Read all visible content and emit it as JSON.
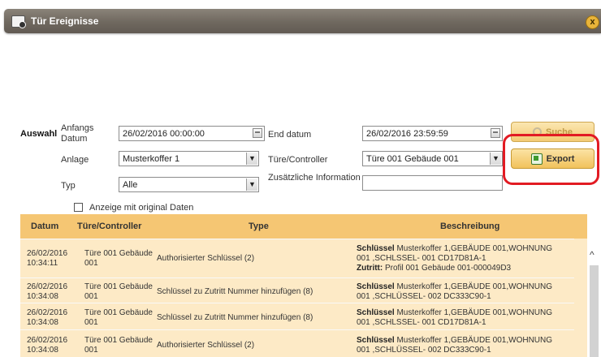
{
  "window": {
    "title": "Tür Ereignisse",
    "close_glyph": "x"
  },
  "filters": {
    "section_label": "Auswahl",
    "start_label_line1": "Anfangs",
    "start_label_line2": "Datum",
    "start_value": "26/02/2016 00:00:00",
    "end_label": "End datum",
    "end_value": "26/02/2016 23:59:59",
    "anlage_label": "Anlage",
    "anlage_value": "Musterkoffer 1",
    "door_label": "Türe/Controller",
    "door_value": "Türe 001 Gebäude 001",
    "typ_label": "Typ",
    "typ_value": "Alle",
    "extra_label": "Zusätzliche Information",
    "extra_value": "",
    "original_data_label": "Anzeige mit original Daten"
  },
  "buttons": {
    "search_label": "Suche",
    "export_label": "Export"
  },
  "table": {
    "headers": [
      "Datum",
      "Türe/Controller",
      "Type",
      "Beschreibung"
    ],
    "rows": [
      {
        "date1": "26/02/2016",
        "date2": "10:34:11",
        "door1": "Türe 001 Gebäude",
        "door2": "001",
        "type": "Authorisierter Schlüssel (2)",
        "desc_bold": "Schlüssel",
        "desc1": " Musterkoffer 1,GEBÄUDE 001,WOHNUNG",
        "desc2": "001 ,SCHLSSEL- 001 CD17D81A-1",
        "desc3_bold": "Zutritt:",
        "desc3": " Profil 001 Gebäude 001-000049D3"
      },
      {
        "date1": "26/02/2016",
        "date2": "10:34:08",
        "door1": "Türe 001 Gebäude",
        "door2": "001",
        "type": "Schlüssel zu Zutritt Nummer hinzufügen (8)",
        "desc_bold": "Schlüssel",
        "desc1": " Musterkoffer 1,GEBÄUDE 001,WOHNUNG",
        "desc2": "001 ,SCHLÜSSEL- 002 DC333C90-1"
      },
      {
        "date1": "26/02/2016",
        "date2": "10:34:08",
        "door1": "Türe 001 Gebäude",
        "door2": "001",
        "type": "Schlüssel zu Zutritt Nummer hinzufügen (8)",
        "desc_bold": "Schlüssel",
        "desc1": " Musterkoffer 1,GEBÄUDE 001,WOHNUNG",
        "desc2": "001 ,SCHLSSEL- 001 CD17D81A-1"
      },
      {
        "date1": "26/02/2016",
        "date2": "10:34:08",
        "door1": "Türe 001 Gebäude",
        "door2": "001",
        "type": "Authorisierter Schlüssel (2)",
        "desc_bold": "Schlüssel",
        "desc1": " Musterkoffer 1,GEBÄUDE 001,WOHNUNG",
        "desc2": "001 ,SCHLÜSSEL- 002 DC333C90-1"
      }
    ]
  },
  "scroll": {
    "up_glyph": "^"
  },
  "colors": {
    "header_bg": "#f5c673",
    "body_bg": "#fdeac6",
    "highlight": "#e21b23"
  }
}
